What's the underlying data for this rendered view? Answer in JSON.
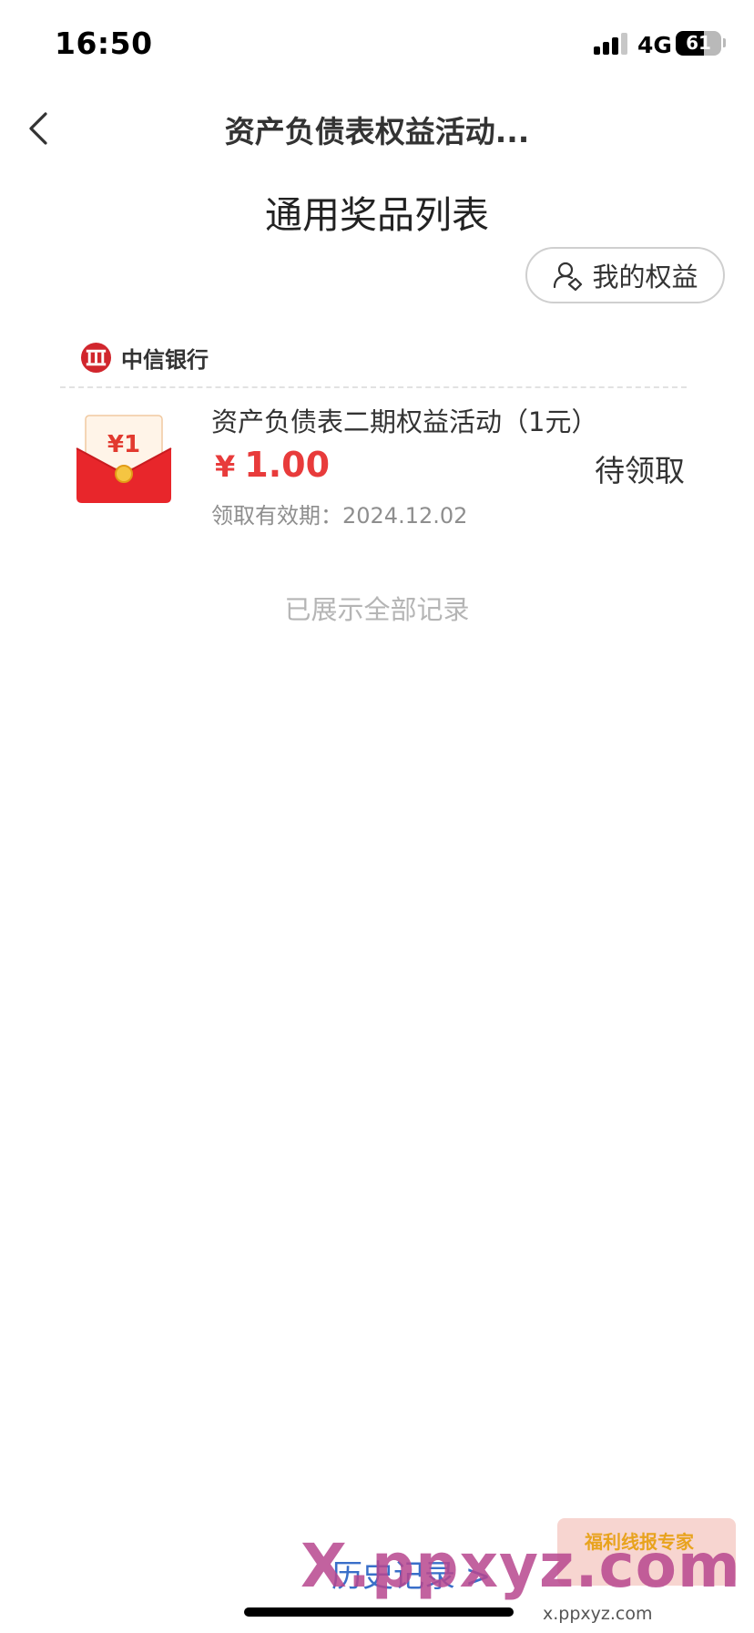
{
  "status_bar": {
    "time": "16:50",
    "network": "4G",
    "battery": "61",
    "battery_level": 0.61
  },
  "nav": {
    "back_icon": "chevron-left-icon",
    "title": "资产负债表权益活动..."
  },
  "section": {
    "title": "通用奖品列表"
  },
  "my_rights": {
    "icon": "users-icon",
    "label": "我的权益"
  },
  "prizes": [
    {
      "bank_name": "中信银行",
      "bank_logo": "citic-logo",
      "title": "资产负债表二期权益活动（1元）",
      "currency": "¥",
      "amount": "1.00",
      "status": "待领取",
      "validity": "领取有效期：2024.12.02",
      "icon_value": "¥1"
    }
  ],
  "list_end_text": "已展示全部记录",
  "history_link": "历史记录 >",
  "watermark": {
    "main": "X.ppxyz.com",
    "sub": "x.ppxyz.com",
    "badge": "福利线报专家"
  },
  "colors": {
    "accent_red": "#e83b3b",
    "link_blue": "#3a6fc9",
    "muted_text": "#b5b5b5"
  }
}
